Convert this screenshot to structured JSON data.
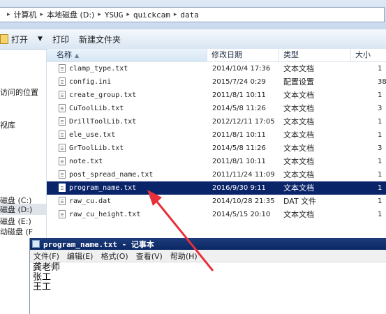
{
  "address": {
    "segments": [
      "计算机",
      "本地磁盘 (D:)",
      "YSUG",
      "quickcam",
      "data"
    ]
  },
  "toolbar": {
    "open_label": "打开",
    "print_label": "打印",
    "new_folder_label": "新建文件夹"
  },
  "nav": {
    "items": [
      {
        "label": "访问的位置"
      },
      {
        "label": "视库"
      },
      {
        "label": "磁盘 (C:)"
      },
      {
        "label": "磁盘 (D:)",
        "selected": true
      },
      {
        "label": "磁盘 (E:)"
      },
      {
        "label": "动磁盘 (F"
      }
    ]
  },
  "columns": {
    "name": "名称",
    "date": "修改日期",
    "type": "类型",
    "size": "大小"
  },
  "files": [
    {
      "name": "clamp_type.txt",
      "date": "2014/10/4 17:36",
      "type": "文本文档",
      "size": "1"
    },
    {
      "name": "config.ini",
      "date": "2015/7/24 0:29",
      "type": "配置设置",
      "size": "38"
    },
    {
      "name": "create_group.txt",
      "date": "2011/8/1 10:11",
      "type": "文本文档",
      "size": "1"
    },
    {
      "name": "CuToolLib.txt",
      "date": "2014/5/8 11:26",
      "type": "文本文档",
      "size": "3"
    },
    {
      "name": "DrillToolLib.txt",
      "date": "2012/12/11 17:05",
      "type": "文本文档",
      "size": "1"
    },
    {
      "name": "ele_use.txt",
      "date": "2011/8/1 10:11",
      "type": "文本文档",
      "size": "1"
    },
    {
      "name": "GrToolLib.txt",
      "date": "2014/5/8 11:26",
      "type": "文本文档",
      "size": "3"
    },
    {
      "name": "note.txt",
      "date": "2011/8/1 10:11",
      "type": "文本文档",
      "size": "1"
    },
    {
      "name": "post_spread_name.txt",
      "date": "2011/11/24 11:09",
      "type": "文本文档",
      "size": "1"
    },
    {
      "name": "program_name.txt",
      "date": "2016/9/30 9:11",
      "type": "文本文档",
      "size": "1",
      "selected": true
    },
    {
      "name": "raw_cu.dat",
      "date": "2014/10/28 21:35",
      "type": "DAT 文件",
      "size": "1"
    },
    {
      "name": "raw_cu_height.txt",
      "date": "2014/5/15 20:10",
      "type": "文本文档",
      "size": "1"
    }
  ],
  "notepad": {
    "title": "program_name.txt - 记事本",
    "menu": [
      "文件(F)",
      "编辑(E)",
      "格式(O)",
      "查看(V)",
      "帮助(H)"
    ],
    "lines": [
      "龚老师",
      "张工",
      "王工"
    ]
  },
  "colors": {
    "selection": "#0a246a",
    "title_bar": "#0b2766",
    "annotation_arrow": "#e8303a"
  }
}
